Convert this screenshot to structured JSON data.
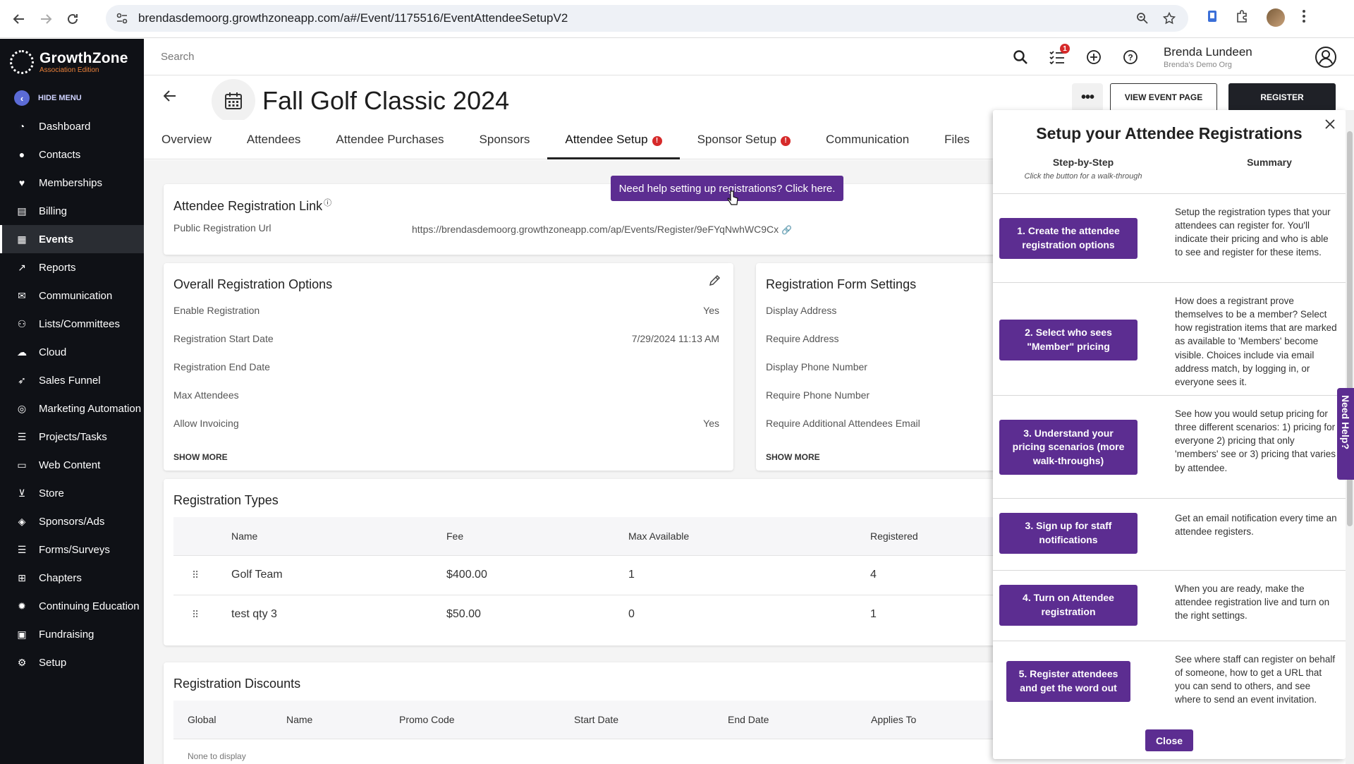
{
  "browser": {
    "url": "brendasdemoorg.growthzoneapp.com/a#/Event/1175516/EventAttendeeSetupV2"
  },
  "sidebar": {
    "logo_title": "GrowthZone",
    "logo_subtitle": "Association Edition",
    "hide_menu": "HIDE MENU",
    "items": [
      {
        "label": "Dashboard",
        "icon": "gauge-icon"
      },
      {
        "label": "Contacts",
        "icon": "person-icon"
      },
      {
        "label": "Memberships",
        "icon": "heart-icon"
      },
      {
        "label": "Billing",
        "icon": "bill-icon"
      },
      {
        "label": "Events",
        "icon": "events-icon"
      },
      {
        "label": "Reports",
        "icon": "chart-icon"
      },
      {
        "label": "Communication",
        "icon": "envelope-icon"
      },
      {
        "label": "Lists/Committees",
        "icon": "people-icon"
      },
      {
        "label": "Cloud",
        "icon": "cloud-icon"
      },
      {
        "label": "Sales Funnel",
        "icon": "rocket-icon"
      },
      {
        "label": "Marketing Automation",
        "icon": "target-icon"
      },
      {
        "label": "Projects/Tasks",
        "icon": "tasks-icon"
      },
      {
        "label": "Web Content",
        "icon": "web-icon"
      },
      {
        "label": "Store",
        "icon": "cart-icon"
      },
      {
        "label": "Sponsors/Ads",
        "icon": "sponsor-icon"
      },
      {
        "label": "Forms/Surveys",
        "icon": "list-icon"
      },
      {
        "label": "Chapters",
        "icon": "hierarchy-icon"
      },
      {
        "label": "Continuing Education",
        "icon": "badge-icon"
      },
      {
        "label": "Fundraising",
        "icon": "gift-icon"
      },
      {
        "label": "Setup",
        "icon": "gear-icon"
      }
    ],
    "active_index": 4
  },
  "topbar": {
    "search_placeholder": "Search",
    "tasks_badge": "1",
    "user_name": "Brenda Lundeen",
    "user_org": "Brenda's Demo Org"
  },
  "event": {
    "title": "Fall Golf Classic 2024",
    "more": "•••",
    "view_event_page": "VIEW EVENT PAGE",
    "register": "REGISTER"
  },
  "tabs": [
    {
      "label": "Overview",
      "warn": false
    },
    {
      "label": "Attendees",
      "warn": false
    },
    {
      "label": "Attendee Purchases",
      "warn": false
    },
    {
      "label": "Sponsors",
      "warn": false
    },
    {
      "label": "Attendee Setup",
      "warn": true
    },
    {
      "label": "Sponsor Setup",
      "warn": true
    },
    {
      "label": "Communication",
      "warn": false
    },
    {
      "label": "Files",
      "warn": false
    }
  ],
  "help_banner": "Need help setting up registrations? Click here.",
  "registration_link": {
    "title": "Attendee Registration Link",
    "label": "Public Registration Url",
    "url": "https://brendasdemoorg.growthzoneapp.com/ap/Events/Register/9eFYqNwhWC9Cx"
  },
  "overall_options": {
    "title": "Overall Registration Options",
    "rows": [
      {
        "label": "Enable Registration",
        "value": "Yes"
      },
      {
        "label": "Registration Start Date",
        "value": "7/29/2024 11:13 AM"
      },
      {
        "label": "Registration End Date",
        "value": ""
      },
      {
        "label": "Max Attendees",
        "value": ""
      },
      {
        "label": "Allow Invoicing",
        "value": "Yes"
      }
    ],
    "show_more": "SHOW MORE"
  },
  "form_settings": {
    "title": "Registration Form Settings",
    "rows": [
      {
        "label": "Display Address"
      },
      {
        "label": "Require Address"
      },
      {
        "label": "Display Phone Number"
      },
      {
        "label": "Require Phone Number"
      },
      {
        "label": "Require Additional Attendees Email"
      }
    ],
    "show_more": "SHOW MORE"
  },
  "registration_types": {
    "title": "Registration Types",
    "headers": [
      "Name",
      "Fee",
      "Max Available",
      "Registered"
    ],
    "rows": [
      {
        "name": "Golf Team",
        "fee": "$400.00",
        "max": "1",
        "registered": "4"
      },
      {
        "name": "test qty 3",
        "fee": "$50.00",
        "max": "0",
        "registered": "1"
      }
    ]
  },
  "registration_discounts": {
    "title": "Registration Discounts",
    "headers": [
      "Global",
      "Name",
      "Promo Code",
      "Start Date",
      "End Date",
      "Applies To"
    ],
    "empty": "None to display"
  },
  "panel": {
    "title": "Setup your Attendee Registrations",
    "tab_step": "Step-by-Step",
    "tab_step_sub": "Click the button for a walk-through",
    "tab_summary": "Summary",
    "steps": [
      {
        "button": "1. Create the attendee registration options",
        "desc": "Setup the registration types that your attendees can register for. You'll indicate their pricing and who is able to see and register for these items."
      },
      {
        "button": "2. Select who sees \"Member\" pricing",
        "desc": "How does a registrant prove themselves to be a member? Select how registration items that are marked as available to 'Members' become visible. Choices include via email address match, by logging in, or everyone sees it."
      },
      {
        "button": "3. Understand your pricing scenarios (more walk-throughs)",
        "desc": "See how you would setup pricing for three different scenarios: 1) pricing for everyone 2) pricing that only 'members' see or 3) pricing that varies by attendee."
      },
      {
        "button": "3. Sign up for staff notifications",
        "desc": "Get an email notification every time an attendee registers."
      },
      {
        "button": "4. Turn on Attendee registration",
        "desc": "When you are ready, make the attendee registration live and turn on the right settings."
      },
      {
        "button": "5. Register attendees and get the word out",
        "desc": "See where staff can register on behalf of someone, how to get a URL that you can send to others, and see where to send an event invitation."
      }
    ],
    "close": "Close"
  },
  "need_help_tab": "Need Help?",
  "colors": {
    "accent_purple": "#5c2d91",
    "sidebar_bg": "#0f1116",
    "alert_red": "#d62a2a"
  }
}
